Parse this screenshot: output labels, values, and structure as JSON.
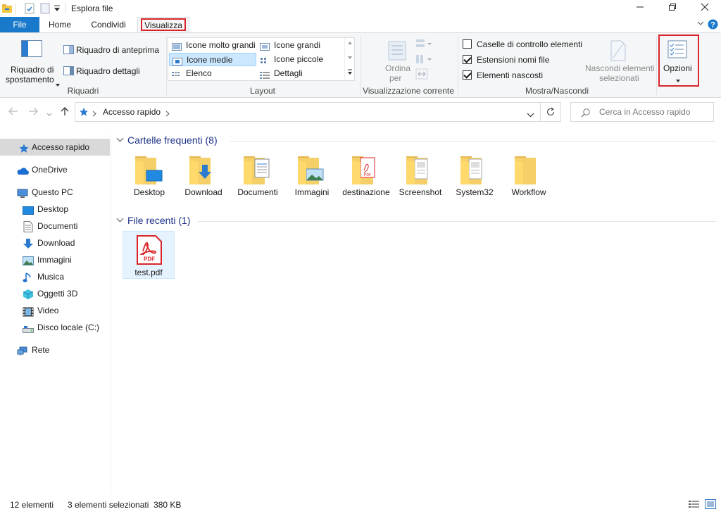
{
  "window": {
    "title": "Esplora file",
    "minimize_icon": "minimize-icon",
    "maximize_icon": "restore-icon",
    "close_icon": "close-icon"
  },
  "tabs": [
    {
      "label": "File"
    },
    {
      "label": "Home"
    },
    {
      "label": "Condividi"
    },
    {
      "label": "Visualizza"
    }
  ],
  "ribbon": {
    "riquadri": {
      "label": "Riquadri",
      "nav_pane_line1": "Riquadro di",
      "nav_pane_line2": "spostamento",
      "preview": "Riquadro di anteprima",
      "details": "Riquadro dettagli"
    },
    "layout": {
      "label": "Layout",
      "items": [
        "Icone molto grandi",
        "Icone grandi",
        "Icone medie",
        "Icone piccole",
        "Elenco",
        "Dettagli"
      ],
      "selected": "Icone medie"
    },
    "current_view": {
      "label": "Visualizzazione corrente",
      "sort_line1": "Ordina",
      "sort_line2": "per"
    },
    "show_hide": {
      "label": "Mostra/Nascondi",
      "checkboxes": [
        {
          "label": "Caselle di controllo elementi",
          "checked": false
        },
        {
          "label": "Estensioni nomi file",
          "checked": true
        },
        {
          "label": "Elementi nascosti",
          "checked": true
        }
      ],
      "hide_line1": "Nascondi elementi",
      "hide_line2": "selezionati"
    },
    "options": {
      "label": "Opzioni"
    }
  },
  "address": {
    "path": "Accesso rapido",
    "search_placeholder": "Cerca in Accesso rapido"
  },
  "nav": [
    {
      "label": "Accesso rapido",
      "icon": "star-icon",
      "selected": true
    },
    {
      "label": "OneDrive",
      "icon": "cloud-icon"
    },
    {
      "label": "Questo PC",
      "icon": "pc-icon"
    },
    {
      "label": "Desktop",
      "icon": "desktop-icon"
    },
    {
      "label": "Documenti",
      "icon": "document-icon"
    },
    {
      "label": "Download",
      "icon": "download-icon"
    },
    {
      "label": "Immagini",
      "icon": "image-icon"
    },
    {
      "label": "Musica",
      "icon": "music-icon"
    },
    {
      "label": "Oggetti 3D",
      "icon": "cube-icon"
    },
    {
      "label": "Video",
      "icon": "video-icon"
    },
    {
      "label": "Disco locale (C:)",
      "icon": "disk-icon"
    },
    {
      "label": "Rete",
      "icon": "network-icon"
    }
  ],
  "content": {
    "frequent_header": "Cartelle frequenti (8)",
    "frequent": [
      {
        "label": "Desktop",
        "overlay": "desktop"
      },
      {
        "label": "Download",
        "overlay": "download"
      },
      {
        "label": "Documenti",
        "overlay": "document"
      },
      {
        "label": "Immagini",
        "overlay": "image"
      },
      {
        "label": "destinazione",
        "overlay": "pdf"
      },
      {
        "label": "Screenshot",
        "overlay": "paper"
      },
      {
        "label": "System32",
        "overlay": "paper"
      },
      {
        "label": "Workflow",
        "overlay": "none"
      }
    ],
    "recent_header": "File recenti (1)",
    "recent": [
      {
        "label": "test.pdf",
        "badge": "PDF"
      }
    ]
  },
  "status": {
    "count": "12 elementi",
    "selection": "3 elementi selezionati  380 KB"
  },
  "colors": {
    "accent": "#1979ca",
    "highlight_box": "#d9252a",
    "folder": "#ffd96b",
    "pdf_red": "#d9252a"
  }
}
